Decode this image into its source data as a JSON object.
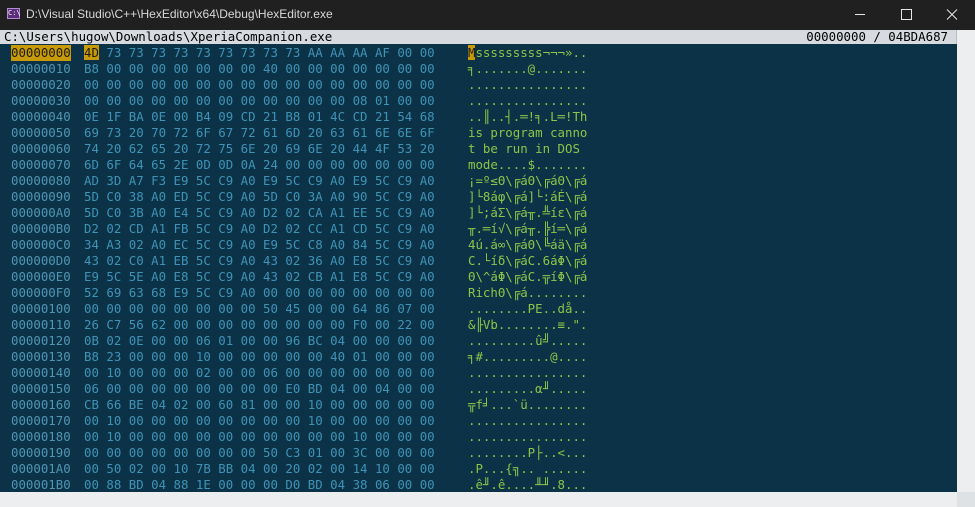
{
  "window": {
    "title": "D:\\Visual Studio\\C++\\HexEditor\\x64\\Debug\\HexEditor.exe",
    "icon": "console-app-icon",
    "icon_glyph": "C:\\",
    "controls": {
      "minimize": "minimize-icon",
      "maximize": "maximize-icon",
      "close": "close-icon"
    }
  },
  "header": {
    "file_path": "C:\\Users\\hugow\\Downloads\\XperiaCompanion.exe",
    "offset_info": "00000000 / 04BDA687"
  },
  "colors": {
    "background": "#0b3246",
    "address": "#4f95b4",
    "hex": "#3f93b7",
    "ascii": "#8dc449",
    "selection": "#c89a08"
  },
  "cursor": {
    "row": 0,
    "byte": 0
  },
  "rows": [
    {
      "address": "00000000",
      "first_byte": "4D",
      "rest_bytes": "73 73 73 73 73 73 73 73 73 AA AA AA AF 00 00",
      "first_char": "M",
      "rest_chars": "sssssssss¬¬¬».."
    },
    {
      "address": "00000010",
      "first_byte": "B8",
      "rest_bytes": "00 00 00 00 00 00 00 40 00 00 00 00 00 00 00",
      "first_char": "╕",
      "rest_chars": ".......@......."
    },
    {
      "address": "00000020",
      "first_byte": "00",
      "rest_bytes": "00 00 00 00 00 00 00 00 00 00 00 00 00 00 00",
      "first_char": ".",
      "rest_chars": "..............."
    },
    {
      "address": "00000030",
      "first_byte": "00",
      "rest_bytes": "00 00 00 00 00 00 00 00 00 00 00 08 01 00 00",
      "first_char": ".",
      "rest_chars": "..............."
    },
    {
      "address": "00000040",
      "first_byte": "0E",
      "rest_bytes": "1F BA 0E 00 B4 09 CD 21 B8 01 4C CD 21 54 68",
      "first_char": ".",
      "rest_chars": ".║..┤.═!╕.L═!Th"
    },
    {
      "address": "00000050",
      "first_byte": "69",
      "rest_bytes": "73 20 70 72 6F 67 72 61 6D 20 63 61 6E 6E 6F",
      "first_char": "i",
      "rest_chars": "s program canno"
    },
    {
      "address": "00000060",
      "first_byte": "74",
      "rest_bytes": "20 62 65 20 72 75 6E 20 69 6E 20 44 4F 53 20",
      "first_char": "t",
      "rest_chars": " be run in DOS "
    },
    {
      "address": "00000070",
      "first_byte": "6D",
      "rest_bytes": "6F 64 65 2E 0D 0D 0A 24 00 00 00 00 00 00 00",
      "first_char": "m",
      "rest_chars": "ode....$......."
    },
    {
      "address": "00000080",
      "first_byte": "AD",
      "rest_bytes": "3D A7 F3 E9 5C C9 A0 E9 5C C9 A0 E9 5C C9 A0",
      "first_char": "¡",
      "rest_chars": "=º≤Θ\\╔áΘ\\╔áΘ\\╔á"
    },
    {
      "address": "00000090",
      "first_byte": "5D",
      "rest_bytes": "C0 38 A0 ED 5C C9 A0 5D C0 3A A0 90 5C C9 A0",
      "first_char": "]",
      "rest_chars": "└8áφ\\╔á]└:áÉ\\╔á"
    },
    {
      "address": "000000A0",
      "first_byte": "5D",
      "rest_bytes": "C0 3B A0 E4 5C C9 A0 D2 02 CA A1 EE 5C C9 A0",
      "first_char": "]",
      "rest_chars": "└;áΣ\\╔á╥.╩íε\\╔á"
    },
    {
      "address": "000000B0",
      "first_byte": "D2",
      "rest_bytes": "02 CD A1 FB 5C C9 A0 D2 02 CC A1 CD 5C C9 A0",
      "first_char": "╥",
      "rest_chars": ".═í√\\╔á╥.╠í═\\╔á"
    },
    {
      "address": "000000C0",
      "first_byte": "34",
      "rest_bytes": "A3 02 A0 EC 5C C9 A0 E9 5C C8 A0 84 5C C9 A0",
      "first_char": "4",
      "rest_chars": "ú.á∞\\╔áΘ\\╚áä\\╔á"
    },
    {
      "address": "000000D0",
      "first_byte": "43",
      "rest_bytes": "02 C0 A1 EB 5C C9 A0 43 02 36 A0 E8 5C C9 A0",
      "first_char": "C",
      "rest_chars": ".└íδ\\╔áC.6áΦ\\╔á"
    },
    {
      "address": "000000E0",
      "first_byte": "E9",
      "rest_bytes": "5C 5E A0 E8 5C C9 A0 43 02 CB A1 E8 5C C9 A0",
      "first_char": "Θ",
      "rest_chars": "\\^áΦ\\╔áC.╦íΦ\\╔á"
    },
    {
      "address": "000000F0",
      "first_byte": "52",
      "rest_bytes": "69 63 68 E9 5C C9 A0 00 00 00 00 00 00 00 00",
      "first_char": "R",
      "rest_chars": "ichΘ\\╔á........"
    },
    {
      "address": "00000100",
      "first_byte": "00",
      "rest_bytes": "00 00 00 00 00 00 00 50 45 00 00 64 86 07 00",
      "first_char": ".",
      "rest_chars": ".......PE..då.."
    },
    {
      "address": "00000110",
      "first_byte": "26",
      "rest_bytes": "C7 56 62 00 00 00 00 00 00 00 00 F0 00 22 00",
      "first_char": "&",
      "rest_chars": "╟Vb........≡.\"."
    },
    {
      "address": "00000120",
      "first_byte": "0B",
      "rest_bytes": "02 0E 00 00 06 01 00 00 96 BC 04 00 00 00 00",
      "first_char": ".",
      "rest_chars": "........û╝....."
    },
    {
      "address": "00000130",
      "first_byte": "B8",
      "rest_bytes": "23 00 00 00 10 00 00 00 00 00 40 01 00 00 00",
      "first_char": "╕",
      "rest_chars": "#.........@...."
    },
    {
      "address": "00000140",
      "first_byte": "00",
      "rest_bytes": "10 00 00 00 02 00 00 06 00 00 00 00 00 00 00",
      "first_char": ".",
      "rest_chars": "..............."
    },
    {
      "address": "00000150",
      "first_byte": "06",
      "rest_bytes": "00 00 00 00 00 00 00 00 E0 BD 04 00 04 00 00",
      "first_char": ".",
      "rest_chars": "........α╜....."
    },
    {
      "address": "00000160",
      "first_byte": "CB",
      "rest_bytes": "66 BE 04 02 00 60 81 00 00 10 00 00 00 00 00",
      "first_char": "╦",
      "rest_chars": "f╛...`ü........"
    },
    {
      "address": "00000170",
      "first_byte": "00",
      "rest_bytes": "10 00 00 00 00 00 00 00 00 10 00 00 00 00 00",
      "first_char": ".",
      "rest_chars": "..............."
    },
    {
      "address": "00000180",
      "first_byte": "00",
      "rest_bytes": "10 00 00 00 00 00 00 00 00 00 00 10 00 00 00",
      "first_char": ".",
      "rest_chars": "..............."
    },
    {
      "address": "00000190",
      "first_byte": "00",
      "rest_bytes": "00 00 00 00 00 00 00 50 C3 01 00 3C 00 00 00",
      "first_char": ".",
      "rest_chars": ".......P├..<..."
    },
    {
      "address": "000001A0",
      "first_byte": "00",
      "rest_bytes": "50 02 00 10 7B BB 04 00 20 02 00 14 10 00 00",
      "first_char": ".",
      "rest_chars": "P...{╗.. ......"
    },
    {
      "address": "000001B0",
      "first_byte": "00",
      "rest_bytes": "88 BD 04 88 1E 00 00 00 D0 BD 04 38 06 00 00",
      "first_char": ".",
      "rest_chars": "ê╜.ê....╨╜.8..."
    }
  ]
}
